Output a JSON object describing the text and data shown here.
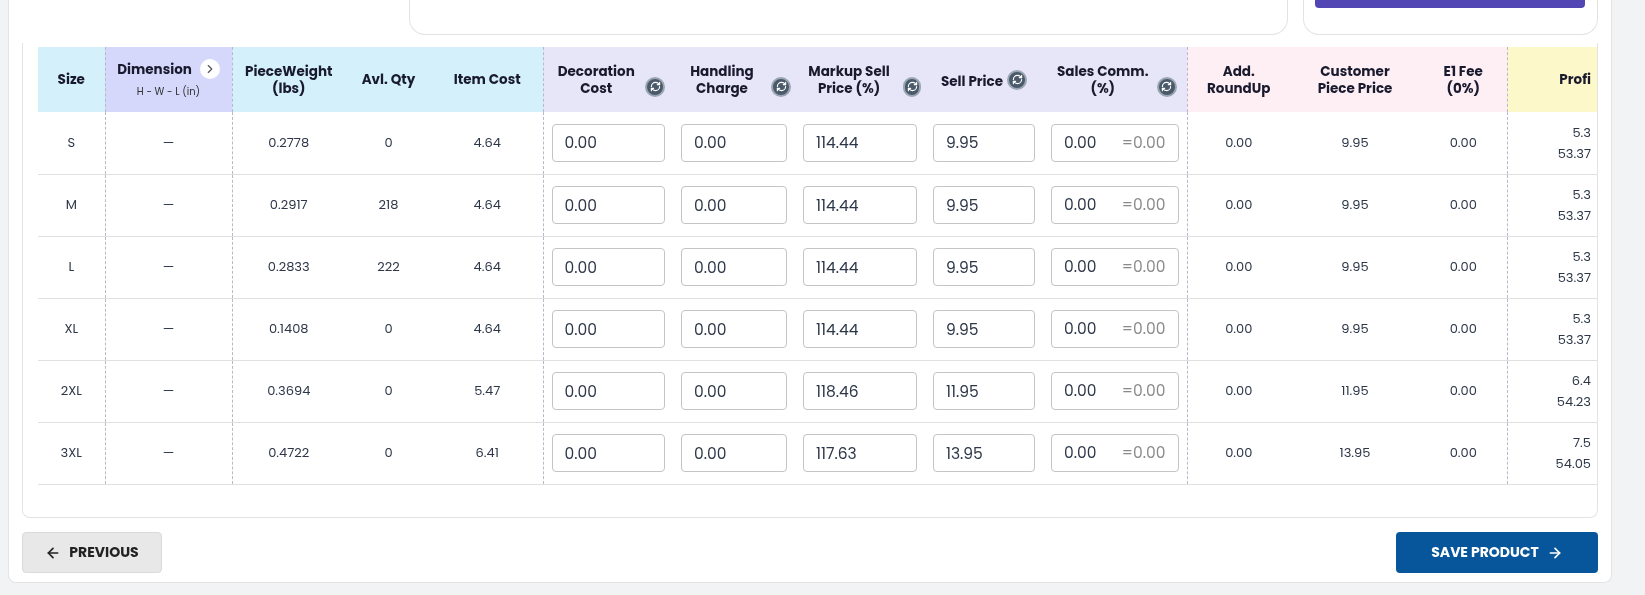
{
  "columns": [
    {
      "label": "Size",
      "color": "#d3f0fb",
      "kind": "text"
    },
    {
      "label": "Dimension",
      "sublabel": "H - W - L (in)",
      "color": "#d5d8fb",
      "kind": "text",
      "expand": true
    },
    {
      "label": "PieceWeight (lbs)",
      "color": "#d3f0fb",
      "kind": "text"
    },
    {
      "label": "Avl. Qty",
      "color": "#d3f0fb",
      "kind": "text"
    },
    {
      "label": "Item Cost",
      "color": "#d3f0fb",
      "kind": "text"
    },
    {
      "label": "Decoration Cost",
      "color": "#e6e6f8",
      "kind": "input",
      "refresh": true
    },
    {
      "label": "Handling Charge",
      "color": "#e6e6f8",
      "kind": "input",
      "refresh": true
    },
    {
      "label": "Markup Sell Price (%)",
      "color": "#e6e6f8",
      "kind": "input",
      "refresh": true
    },
    {
      "label": "Sell Price",
      "color": "#e6e6f8",
      "kind": "input",
      "refresh": true
    },
    {
      "label": "Sales Comm. (%)",
      "color": "#e6e6f8",
      "kind": "split_input",
      "refresh": true
    },
    {
      "label": "Add. RoundUp",
      "color": "#fdeff4",
      "kind": "text"
    },
    {
      "label": "Customer Piece Price",
      "color": "#fdeff4",
      "kind": "text"
    },
    {
      "label": "E1 Fee (0%)",
      "color": "#fdeff4",
      "kind": "text"
    },
    {
      "label": "Profi",
      "color": "#fdf8c9",
      "kind": "stacked"
    }
  ],
  "rows": [
    {
      "cells": [
        "S",
        "—",
        "0.2778",
        "0",
        "4.64",
        "0.00",
        "0.00",
        "114.44",
        "9.95",
        {
          "value": "0.00",
          "amount": "=0.00"
        },
        "0.00",
        "9.95",
        "0.00",
        {
          "amount": "5.3",
          "percent": "53.37"
        }
      ]
    },
    {
      "cells": [
        "M",
        "—",
        "0.2917",
        "218",
        "4.64",
        "0.00",
        "0.00",
        "114.44",
        "9.95",
        {
          "value": "0.00",
          "amount": "=0.00"
        },
        "0.00",
        "9.95",
        "0.00",
        {
          "amount": "5.3",
          "percent": "53.37"
        }
      ]
    },
    {
      "cells": [
        "L",
        "—",
        "0.2833",
        "222",
        "4.64",
        "0.00",
        "0.00",
        "114.44",
        "9.95",
        {
          "value": "0.00",
          "amount": "=0.00"
        },
        "0.00",
        "9.95",
        "0.00",
        {
          "amount": "5.3",
          "percent": "53.37"
        }
      ]
    },
    {
      "cells": [
        "XL",
        "—",
        "0.1408",
        "0",
        "4.64",
        "0.00",
        "0.00",
        "114.44",
        "9.95",
        {
          "value": "0.00",
          "amount": "=0.00"
        },
        "0.00",
        "9.95",
        "0.00",
        {
          "amount": "5.3",
          "percent": "53.37"
        }
      ]
    },
    {
      "cells": [
        "2XL",
        "—",
        "0.3694",
        "0",
        "5.47",
        "0.00",
        "0.00",
        "118.46",
        "11.95",
        {
          "value": "0.00",
          "amount": "=0.00"
        },
        "0.00",
        "11.95",
        "0.00",
        {
          "amount": "6.4",
          "percent": "54.23"
        }
      ]
    },
    {
      "cells": [
        "3XL",
        "—",
        "0.4722",
        "0",
        "6.41",
        "0.00",
        "0.00",
        "117.63",
        "13.95",
        {
          "value": "0.00",
          "amount": "=0.00"
        },
        "0.00",
        "13.95",
        "0.00",
        {
          "amount": "7.5",
          "percent": "54.05"
        }
      ]
    }
  ],
  "buttons": {
    "previous": "PREVIOUS",
    "save": "SAVE PRODUCT"
  }
}
